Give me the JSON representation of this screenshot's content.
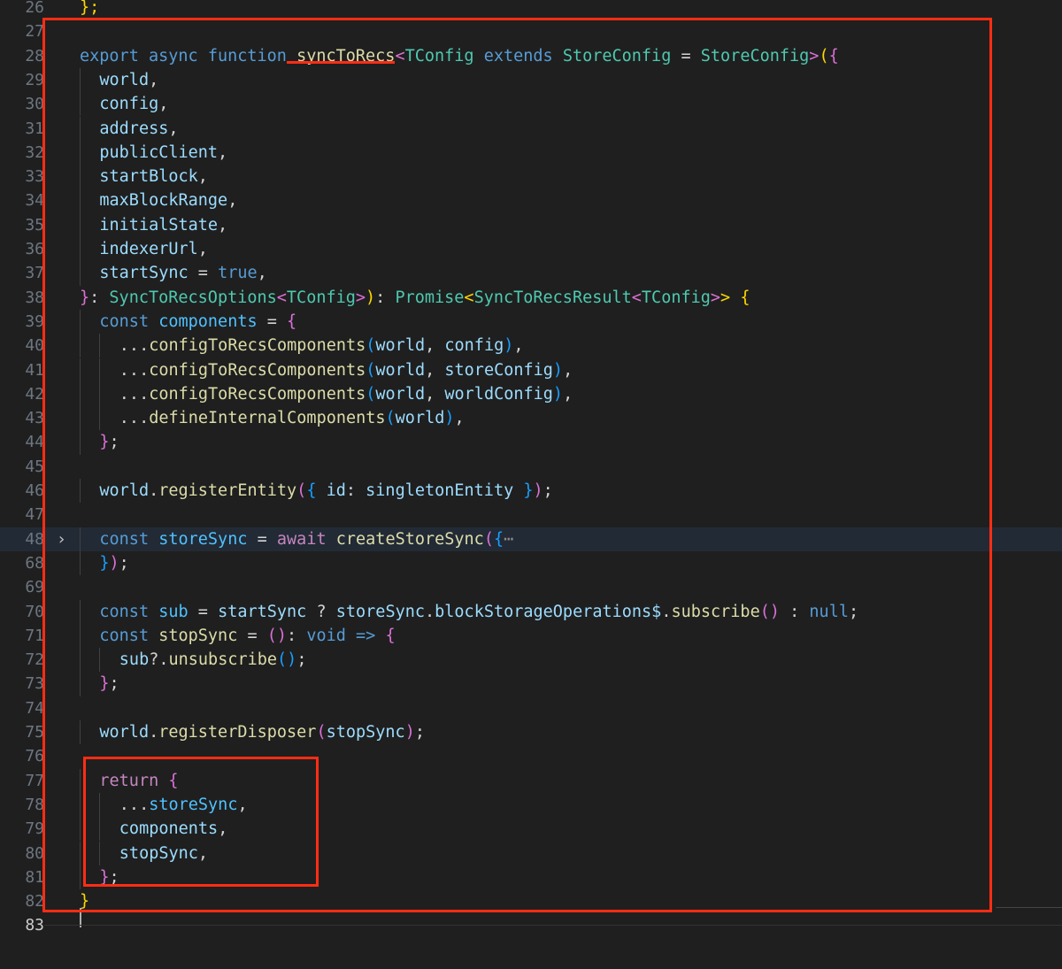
{
  "editor": {
    "lines": [
      {
        "n": "26",
        "tokens": [
          [
            "b1",
            "};"
          ]
        ]
      },
      {
        "n": "27",
        "tokens": []
      },
      {
        "n": "28",
        "tokens": [
          [
            "kw",
            "export"
          ],
          [
            "pu",
            " "
          ],
          [
            "kw",
            "async"
          ],
          [
            "pu",
            " "
          ],
          [
            "kw",
            "function"
          ],
          [
            "pu",
            " "
          ],
          [
            "fn",
            "syncToRecs"
          ],
          [
            "b2",
            "<"
          ],
          [
            "ty",
            "TConfig"
          ],
          [
            "pu",
            " "
          ],
          [
            "kw",
            "extends"
          ],
          [
            "pu",
            " "
          ],
          [
            "ty",
            "StoreConfig"
          ],
          [
            "pu",
            " = "
          ],
          [
            "ty",
            "StoreConfig"
          ],
          [
            "b2",
            ">"
          ],
          [
            "b1",
            "("
          ],
          [
            "b2",
            "{"
          ]
        ]
      },
      {
        "n": "29",
        "indent": 1,
        "tokens": [
          [
            "va",
            "world"
          ],
          [
            "pu",
            ","
          ]
        ]
      },
      {
        "n": "30",
        "indent": 1,
        "tokens": [
          [
            "va",
            "config"
          ],
          [
            "pu",
            ","
          ]
        ]
      },
      {
        "n": "31",
        "indent": 1,
        "tokens": [
          [
            "va",
            "address"
          ],
          [
            "pu",
            ","
          ]
        ]
      },
      {
        "n": "32",
        "indent": 1,
        "tokens": [
          [
            "va",
            "publicClient"
          ],
          [
            "pu",
            ","
          ]
        ]
      },
      {
        "n": "33",
        "indent": 1,
        "tokens": [
          [
            "va",
            "startBlock"
          ],
          [
            "pu",
            ","
          ]
        ]
      },
      {
        "n": "34",
        "indent": 1,
        "tokens": [
          [
            "va",
            "maxBlockRange"
          ],
          [
            "pu",
            ","
          ]
        ]
      },
      {
        "n": "35",
        "indent": 1,
        "tokens": [
          [
            "va",
            "initialState"
          ],
          [
            "pu",
            ","
          ]
        ]
      },
      {
        "n": "36",
        "indent": 1,
        "tokens": [
          [
            "va",
            "indexerUrl"
          ],
          [
            "pu",
            ","
          ]
        ]
      },
      {
        "n": "37",
        "indent": 1,
        "tokens": [
          [
            "va",
            "startSync"
          ],
          [
            "pu",
            " = "
          ],
          [
            "kw",
            "true"
          ],
          [
            "pu",
            ","
          ]
        ]
      },
      {
        "n": "38",
        "tokens": [
          [
            "b2",
            "}"
          ],
          [
            "pu",
            ": "
          ],
          [
            "ty",
            "SyncToRecsOptions"
          ],
          [
            "b2",
            "<"
          ],
          [
            "ty",
            "TConfig"
          ],
          [
            "b2",
            ">"
          ],
          [
            "b1",
            ")"
          ],
          [
            "pu",
            ": "
          ],
          [
            "ty",
            "Promise"
          ],
          [
            "b1",
            "<"
          ],
          [
            "ty",
            "SyncToRecsResult"
          ],
          [
            "b2",
            "<"
          ],
          [
            "ty",
            "TConfig"
          ],
          [
            "b2",
            ">"
          ],
          [
            "b1",
            ">"
          ],
          [
            "pu",
            " "
          ],
          [
            "b1",
            "{"
          ]
        ]
      },
      {
        "n": "39",
        "indent": 1,
        "tokens": [
          [
            "kw",
            "const"
          ],
          [
            "pu",
            " "
          ],
          [
            "cn",
            "components"
          ],
          [
            "pu",
            " = "
          ],
          [
            "b2",
            "{"
          ]
        ]
      },
      {
        "n": "40",
        "indent": 2,
        "tokens": [
          [
            "pu",
            "..."
          ],
          [
            "fn",
            "configToRecsComponents"
          ],
          [
            "b3",
            "("
          ],
          [
            "va",
            "world"
          ],
          [
            "pu",
            ", "
          ],
          [
            "va",
            "config"
          ],
          [
            "b3",
            ")"
          ],
          [
            "pu",
            ","
          ]
        ]
      },
      {
        "n": "41",
        "indent": 2,
        "tokens": [
          [
            "pu",
            "..."
          ],
          [
            "fn",
            "configToRecsComponents"
          ],
          [
            "b3",
            "("
          ],
          [
            "va",
            "world"
          ],
          [
            "pu",
            ", "
          ],
          [
            "va",
            "storeConfig"
          ],
          [
            "b3",
            ")"
          ],
          [
            "pu",
            ","
          ]
        ]
      },
      {
        "n": "42",
        "indent": 2,
        "tokens": [
          [
            "pu",
            "..."
          ],
          [
            "fn",
            "configToRecsComponents"
          ],
          [
            "b3",
            "("
          ],
          [
            "va",
            "world"
          ],
          [
            "pu",
            ", "
          ],
          [
            "va",
            "worldConfig"
          ],
          [
            "b3",
            ")"
          ],
          [
            "pu",
            ","
          ]
        ]
      },
      {
        "n": "43",
        "indent": 2,
        "tokens": [
          [
            "pu",
            "..."
          ],
          [
            "fn",
            "defineInternalComponents"
          ],
          [
            "b3",
            "("
          ],
          [
            "va",
            "world"
          ],
          [
            "b3",
            ")"
          ],
          [
            "pu",
            ","
          ]
        ]
      },
      {
        "n": "44",
        "indent": 1,
        "tokens": [
          [
            "b2",
            "}"
          ],
          [
            "pu",
            ";"
          ]
        ]
      },
      {
        "n": "45",
        "tokens": []
      },
      {
        "n": "46",
        "indent": 1,
        "tokens": [
          [
            "va",
            "world"
          ],
          [
            "pu",
            "."
          ],
          [
            "fn",
            "registerEntity"
          ],
          [
            "b2",
            "("
          ],
          [
            "b3",
            "{"
          ],
          [
            "pu",
            " "
          ],
          [
            "va",
            "id"
          ],
          [
            "pu",
            ": "
          ],
          [
            "va",
            "singletonEntity"
          ],
          [
            "pu",
            " "
          ],
          [
            "b3",
            "}"
          ],
          [
            "b2",
            ")"
          ],
          [
            "pu",
            ";"
          ]
        ]
      },
      {
        "n": "47",
        "tokens": []
      },
      {
        "n": "48",
        "indent": 1,
        "folded": true,
        "current": true,
        "tokens": [
          [
            "kw",
            "const"
          ],
          [
            "pu",
            " "
          ],
          [
            "cn",
            "storeSync"
          ],
          [
            "pu",
            " = "
          ],
          [
            "kwc",
            "await"
          ],
          [
            "pu",
            " "
          ],
          [
            "fn",
            "createStoreSync"
          ],
          [
            "b2",
            "("
          ],
          [
            "b3",
            "{"
          ],
          [
            "ellipsis",
            "⋯"
          ]
        ]
      },
      {
        "n": "68",
        "indent": 1,
        "tokens": [
          [
            "b3",
            "}"
          ],
          [
            "b2",
            ")"
          ],
          [
            "pu",
            ";"
          ]
        ]
      },
      {
        "n": "69",
        "tokens": []
      },
      {
        "n": "70",
        "indent": 1,
        "tokens": [
          [
            "kw",
            "const"
          ],
          [
            "pu",
            " "
          ],
          [
            "cn",
            "sub"
          ],
          [
            "pu",
            " = "
          ],
          [
            "va",
            "startSync"
          ],
          [
            "pu",
            " ? "
          ],
          [
            "va",
            "storeSync"
          ],
          [
            "pu",
            "."
          ],
          [
            "va",
            "blockStorageOperations$"
          ],
          [
            "pu",
            "."
          ],
          [
            "fn",
            "subscribe"
          ],
          [
            "b2",
            "()"
          ],
          [
            "pu",
            " : "
          ],
          [
            "kw",
            "null"
          ],
          [
            "pu",
            ";"
          ]
        ]
      },
      {
        "n": "71",
        "indent": 1,
        "tokens": [
          [
            "kw",
            "const"
          ],
          [
            "pu",
            " "
          ],
          [
            "fn",
            "stopSync"
          ],
          [
            "pu",
            " = "
          ],
          [
            "b2",
            "()"
          ],
          [
            "pu",
            ": "
          ],
          [
            "kw",
            "void"
          ],
          [
            "pu",
            " "
          ],
          [
            "kw",
            "=>"
          ],
          [
            "pu",
            " "
          ],
          [
            "b2",
            "{"
          ]
        ]
      },
      {
        "n": "72",
        "indent": 2,
        "tokens": [
          [
            "va",
            "sub"
          ],
          [
            "pu",
            "?."
          ],
          [
            "fn",
            "unsubscribe"
          ],
          [
            "b3",
            "()"
          ],
          [
            "pu",
            ";"
          ]
        ]
      },
      {
        "n": "73",
        "indent": 1,
        "tokens": [
          [
            "b2",
            "}"
          ],
          [
            "pu",
            ";"
          ]
        ]
      },
      {
        "n": "74",
        "tokens": []
      },
      {
        "n": "75",
        "indent": 1,
        "tokens": [
          [
            "va",
            "world"
          ],
          [
            "pu",
            "."
          ],
          [
            "fn",
            "registerDisposer"
          ],
          [
            "b2",
            "("
          ],
          [
            "va",
            "stopSync"
          ],
          [
            "b2",
            ")"
          ],
          [
            "pu",
            ";"
          ]
        ]
      },
      {
        "n": "76",
        "tokens": []
      },
      {
        "n": "77",
        "indent": 1,
        "tokens": [
          [
            "kwc",
            "return"
          ],
          [
            "pu",
            " "
          ],
          [
            "b2",
            "{"
          ]
        ]
      },
      {
        "n": "78",
        "indent": 2,
        "tokens": [
          [
            "pu",
            "..."
          ],
          [
            "cn",
            "storeSync"
          ],
          [
            "pu",
            ","
          ]
        ]
      },
      {
        "n": "79",
        "indent": 2,
        "tokens": [
          [
            "va",
            "components"
          ],
          [
            "pu",
            ","
          ]
        ]
      },
      {
        "n": "80",
        "indent": 2,
        "tokens": [
          [
            "va",
            "stopSync"
          ],
          [
            "pu",
            ","
          ]
        ]
      },
      {
        "n": "81",
        "indent": 1,
        "tokens": [
          [
            "b2",
            "}"
          ],
          [
            "pu",
            ";"
          ]
        ]
      },
      {
        "n": "82",
        "tokens": [
          [
            "b1",
            "}"
          ]
        ]
      },
      {
        "n": "83",
        "active": true,
        "tokens": []
      }
    ]
  },
  "annotations": {
    "highlight_color": "#ff2d14"
  }
}
